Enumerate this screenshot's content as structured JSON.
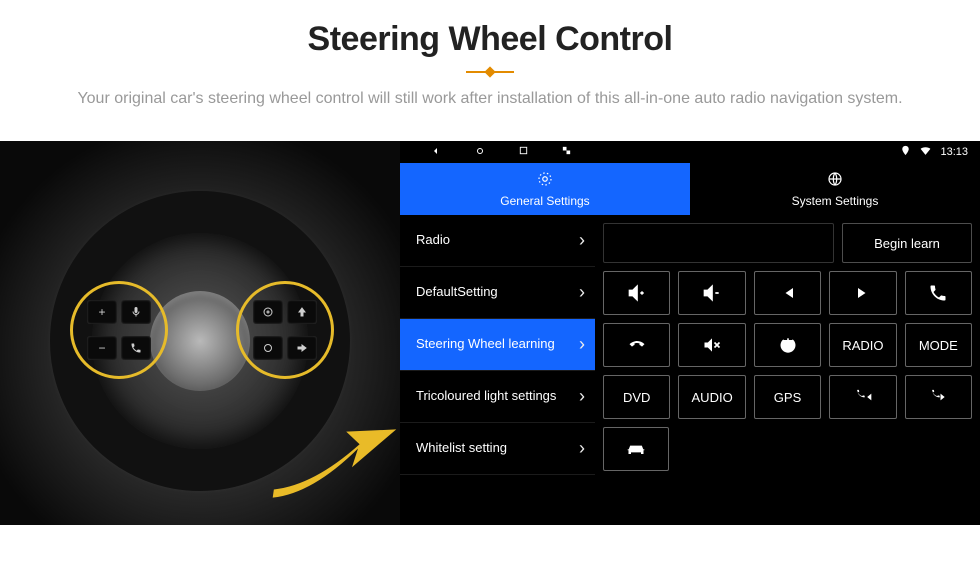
{
  "header": {
    "title": "Steering Wheel Control",
    "subtitle": "Your original car's steering wheel control will still work after installation of this all-in-one auto radio navigation system."
  },
  "statusbar": {
    "time": "13:13"
  },
  "tabs": {
    "general": "General Settings",
    "system": "System Settings",
    "active": "general"
  },
  "sidebar": {
    "items": [
      {
        "label": "Radio"
      },
      {
        "label": "DefaultSetting"
      },
      {
        "label": "Steering Wheel learning"
      },
      {
        "label": "Tricoloured light settings"
      },
      {
        "label": "Whitelist setting"
      }
    ],
    "active_index": 2
  },
  "learn": {
    "begin": "Begin learn"
  },
  "buttons": {
    "row1": [
      "vol-up-icon",
      "vol-down-icon",
      "prev-track-icon",
      "next-track-icon",
      "phone-icon"
    ],
    "row2": [
      "hangup-icon",
      "mute-icon",
      "power-icon",
      "RADIO",
      "MODE"
    ],
    "row3": [
      "DVD",
      "AUDIO",
      "GPS",
      "phone-prev-icon",
      "phone-next-icon"
    ],
    "row4": [
      "car-icon"
    ]
  },
  "steering_pods": {
    "left": [
      "+",
      "voice",
      "-",
      "phone"
    ],
    "right": [
      "disc",
      "up",
      "circle",
      "right"
    ]
  }
}
